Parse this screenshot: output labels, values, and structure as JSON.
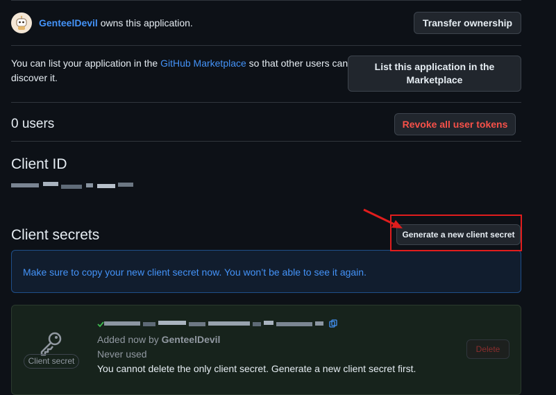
{
  "owner": {
    "username": "GenteelDevil",
    "suffix": " owns this application.",
    "transfer_label": "Transfer ownership"
  },
  "marketplace": {
    "text_before": "You can list your application in the ",
    "link_text": "GitHub Marketplace",
    "text_after": " so that other users can discover it.",
    "button_label": "List this application in the Marketplace"
  },
  "users": {
    "title": "0 users",
    "revoke_label": "Revoke all user tokens"
  },
  "client_id": {
    "title": "Client ID"
  },
  "client_secrets": {
    "title": "Client secrets",
    "generate_label": "Generate a new client secret",
    "flash_text": "Make sure to copy your new client secret now. You won’t be able to see it again.",
    "badge_label": "Client secret",
    "added_prefix": "Added now by ",
    "added_by": "GenteelDevil",
    "usage": "Never used",
    "warning": "You cannot delete the only client secret. Generate a new client secret first.",
    "delete_label": "Delete"
  },
  "colors": {
    "background": "#0d1117",
    "link": "#4493f8",
    "danger": "#f85149",
    "annotation": "#e11d1d"
  },
  "icons": [
    "avatar-robot",
    "key-icon",
    "copy-icon",
    "check-icon"
  ]
}
